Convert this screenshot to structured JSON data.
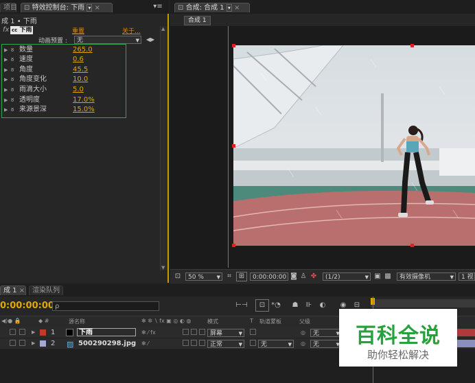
{
  "effects_panel": {
    "tab_left_partial": "项目",
    "tab_title": "特效控制台: 下雨",
    "breadcrumb": "成 1 • 下雨",
    "effect_badge": "cc",
    "effect_name": "下雨",
    "reset_label": "重置",
    "about_label": "关于...",
    "preset_label": "动画预置 :",
    "preset_value": "无",
    "properties": [
      {
        "label": "数量",
        "value": "265.0"
      },
      {
        "label": "速度",
        "value": "0.6"
      },
      {
        "label": "角度",
        "value": "45.5"
      },
      {
        "label": "角度变化",
        "value": "10.0"
      },
      {
        "label": "雨滴大小",
        "value": "5.0"
      },
      {
        "label": "透明度",
        "value": "17.0%"
      },
      {
        "label": "来源景深",
        "value": "15.0%"
      }
    ]
  },
  "composition_panel": {
    "tab_title": "合成: 合成 1",
    "sub_tab": "合成 1",
    "zoom": "50 %",
    "timecode": "0:00:00:00",
    "resolution": "(1/2)",
    "camera": "有效摄像机",
    "views_partial": "1 视"
  },
  "timeline": {
    "tab_comp": "成 1",
    "tab_render": "渲染队列",
    "timecode": "0:00:00:00",
    "search_placeholder": "ρ",
    "col_source": "源名称",
    "col_mode": "模式",
    "col_t": "T",
    "col_trkmat": "轨道蒙板",
    "col_parent": "父级",
    "layers": [
      {
        "num": "1",
        "name": "下雨",
        "mode": "屏幕",
        "trkmat": "",
        "parent": "无",
        "label_color": "#c0392b"
      },
      {
        "num": "2",
        "name": "500290298.jpg",
        "mode": "正常",
        "trkmat": "无",
        "parent": "无",
        "label_color": "#a3a8d6"
      }
    ]
  },
  "watermark": {
    "title": "百科全说",
    "subtitle": "助你轻松解决"
  },
  "colors": {
    "accent_orange": "#e0a800",
    "highlight_green": "#2ea84a",
    "watermark_green": "#25a23c"
  }
}
